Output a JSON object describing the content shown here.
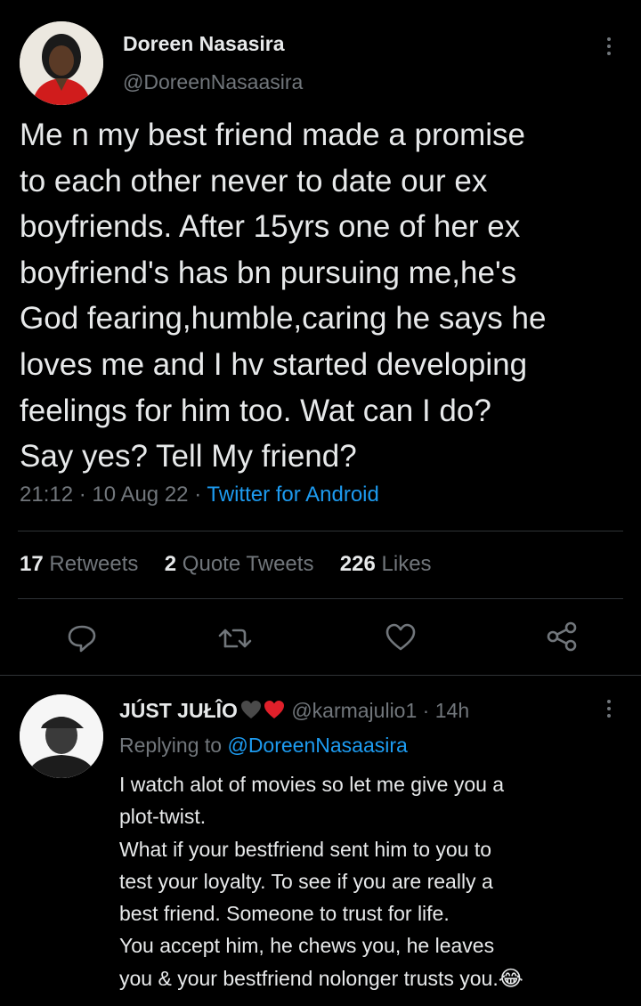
{
  "tweet": {
    "author_name": "Doreen Nasasira",
    "author_handle": "@DoreenNasaasira",
    "text_lines": [
      "Me n my best friend made a promise",
      "to each other never to date our ex",
      "boyfriends. After 15yrs one of her ex",
      "boyfriend's has bn pursuing me,he's",
      "God fearing,humble,caring he says he",
      "loves me and I hv started developing",
      "feelings for him too. Wat can I do?",
      "Say yes? Tell My friend?"
    ],
    "time": "21:12",
    "date": "10 Aug 22",
    "source": "Twitter for Android",
    "separator": "·",
    "stats": {
      "retweets_count": "17",
      "retweets_label": "Retweets",
      "quotes_count": "2",
      "quotes_label": "Quote Tweets",
      "likes_count": "226",
      "likes_label": "Likes"
    },
    "actions": [
      "reply-icon",
      "retweet-icon",
      "like-icon",
      "share-icon"
    ]
  },
  "reply": {
    "author_name": "JÚST JUŁÎO",
    "author_handle": "@karmajulio1",
    "time_ago": "14h",
    "separator": "·",
    "replying_prefix": "Replying to",
    "replying_to": "@DoreenNasaasira",
    "text_lines": [
      "I watch alot of movies so let me give you a",
      "plot-twist.",
      "What if your bestfriend sent him to you to",
      "test your loyalty. To see if you are really a",
      "best friend. Someone to trust for life.",
      "You accept him, he chews you, he leaves",
      "you & your bestfriend nolonger trusts you."
    ],
    "emoji": "😂"
  },
  "colors": {
    "background": "#000000",
    "text": "#e7e9ea",
    "muted": "#71767b",
    "accent": "#1d9bf0",
    "heart_red": "#f91880",
    "divider": "#2f3336"
  }
}
